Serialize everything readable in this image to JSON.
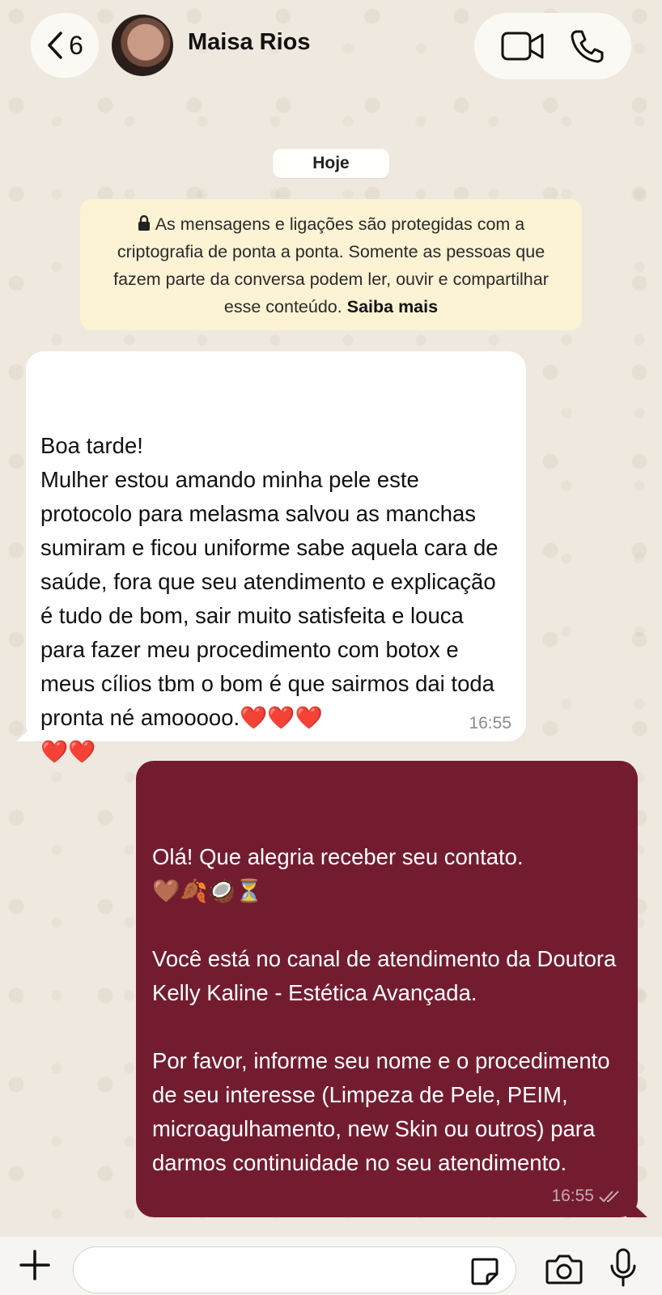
{
  "header": {
    "back_count": "6",
    "contact_name": "Maisa Rios",
    "icons": [
      "chevron-left-icon",
      "video-call-icon",
      "phone-icon"
    ]
  },
  "date_chip": "Hoje",
  "encryption_notice": {
    "text": "As mensagens e ligações são protegidas com a criptografia de ponta a ponta. Somente as pessoas que fazem parte da conversa podem ler, ouvir e compartilhar esse conteúdo.",
    "link": "Saiba mais"
  },
  "messages": [
    {
      "direction": "incoming",
      "text": "Boa tarde!\nMulher estou amando minha pele este protocolo para melasma salvou as manchas sumiram e ficou uniforme sabe aquela cara de saúde, fora que seu atendimento e explicação é tudo de bom, sair muito satisfeita e louca para fazer meu procedimento com botox e meus cílios tbm o bom é que sairmos dai toda pronta né amooooo.❤️❤️❤️\n❤️❤️",
      "time": "16:55"
    },
    {
      "direction": "outgoing",
      "text": "Olá! Que alegria receber seu contato.\n🤎🍂🥥⏳\n\nVocê está no canal de atendimento da Doutora Kelly Kaline - Estética Avançada.\n\nPor favor, informe seu nome e o procedimento de seu interesse (Limpeza de Pele, PEIM, microagulhamento, new Skin ou outros) para darmos continuidade no seu atendimento.",
      "time": "16:55",
      "status": "read-checkmarks"
    }
  ],
  "input_bar": {
    "placeholder": "",
    "icons": [
      "plus-icon",
      "sticker-icon",
      "camera-icon",
      "microphone-icon"
    ]
  },
  "colors": {
    "outgoing_bubble": "#731c30",
    "incoming_bubble": "#ffffff",
    "notice_bg": "#fcf2d4",
    "wallpaper": "#efe8de"
  }
}
